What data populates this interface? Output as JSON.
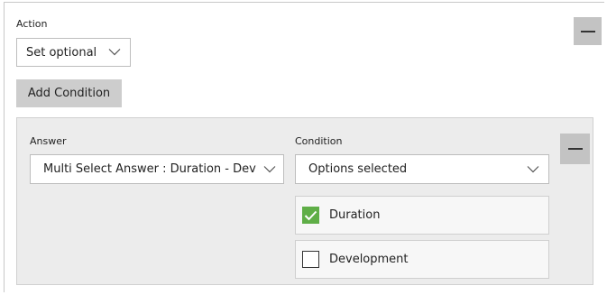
{
  "action": {
    "label": "Action",
    "select_value": "Set optional",
    "remove_button_glyph": "minus-icon"
  },
  "add_condition": {
    "label": "Add Condition"
  },
  "condition_group": {
    "answer_label": "Answer",
    "answer_value": "Multi Select Answer : Duration - Dev",
    "condition_label": "Condition",
    "condition_value": "Options selected",
    "options": [
      {
        "label": "Duration",
        "checked": true
      },
      {
        "label": "Development",
        "checked": false
      }
    ]
  },
  "colors": {
    "check_green": "#5fae47",
    "button_gray": "#cdcdcd",
    "group_background": "#ececec"
  }
}
